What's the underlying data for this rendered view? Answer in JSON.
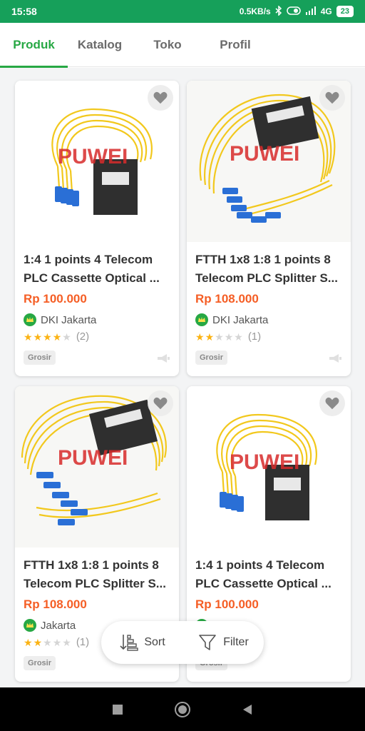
{
  "status_bar": {
    "time": "15:58",
    "network_speed": "0.5KB/s",
    "network_type": "4G",
    "battery": "23"
  },
  "tabs": [
    {
      "label": "Produk",
      "active": true
    },
    {
      "label": "Katalog",
      "active": false
    },
    {
      "label": "Toko",
      "active": false
    },
    {
      "label": "Profil",
      "active": false
    }
  ],
  "products": [
    {
      "title": "1:4 1 points 4 Telecom PLC Cassette Optical ...",
      "price": "Rp 100.000",
      "location": "DKI Jakarta",
      "rating_stars": 4,
      "rating_count": "(2)",
      "badge": "Grosir",
      "image_watermark": "PUWEI"
    },
    {
      "title": "FTTH 1x8 1:8 1 points 8 Telecom PLC Splitter S...",
      "price": "Rp 108.000",
      "location": "DKI Jakarta",
      "rating_stars": 2,
      "rating_count": "(1)",
      "badge": "Grosir",
      "image_watermark": "PUWEI"
    },
    {
      "title": "FTTH 1x8 1:8 1 points 8 Telecom PLC Splitter S...",
      "price": "Rp 108.000",
      "location": "Jakarta",
      "rating_stars": 2,
      "rating_count": "(1)",
      "badge": "Grosir",
      "image_watermark": "PUWEI"
    },
    {
      "title": "1:4 1 points 4 Telecom PLC Cassette Optical ...",
      "price": "Rp 100.000",
      "location": "",
      "rating_stars": 0,
      "rating_count": "",
      "badge": "Grosir",
      "image_watermark": "PUWEI"
    }
  ],
  "float_bar": {
    "sort_label": "Sort",
    "filter_label": "Filter"
  },
  "colors": {
    "brand_green": "#27a844",
    "status_green": "#16a05a",
    "price_orange": "#f55e25",
    "star_yellow": "#fbb314"
  },
  "icons": {
    "favorite": "heart-icon",
    "location_badge": "official-store-icon",
    "sort": "sort-icon",
    "filter": "filter-icon",
    "promo": "megaphone-icon"
  }
}
